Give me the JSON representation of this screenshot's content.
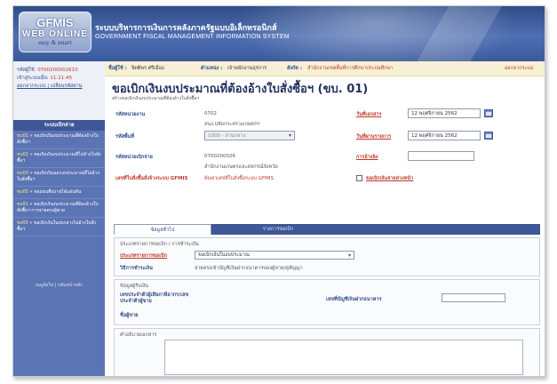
{
  "header": {
    "logo_line1": "GFMIS",
    "logo_line2": "WEB ONLINE",
    "logo_line3": "easy & smart",
    "title_th": "ระบบบริหารการเงินการคลังภาครัฐแบบอิเล็กทรอนิกส์",
    "title_en": "GOVERNMENT FISCAL MANAGEMENT INFORMATION SYSTEM"
  },
  "user": {
    "user_label": "รหัสผู้ใช้:",
    "user_value": "0700200002610",
    "time_label": "เข้าสู่ระบบเมื่อ:",
    "time_value": "11:21:45",
    "menu_link": "ออกจากระบบ | เปลี่ยนรหัสผ่าน"
  },
  "sidebar": {
    "heading": "ระบบเบิกจ่าย",
    "items": [
      {
        "code": "ขบ01",
        "label": "» ขอเบิกเงินงบประมาณที่ต้องอ้างใบสั่งซื้อฯ"
      },
      {
        "code": "ขบ02",
        "label": "» ขอเบิกเงินงบประมาณที่ไม่อ้างใบสั่งซื้อฯ"
      },
      {
        "code": "ขบ03",
        "label": "» ขอเบิกเงินนอกงบประมาณที่ไม่อ้างใบสั่งซื้อฯ"
      },
      {
        "code": "ขบ05",
        "label": "» ขอถอนคืนรายได้แผ่นดิน"
      },
      {
        "code": "ขจ01",
        "label": "» ขอเบิกเงินงบประมาณที่ต้องอ้างใบสั่งซื้อฯ การจ่ายตรงผู้ขาย"
      },
      {
        "code": "ขจ05",
        "label": "» ขอเบิกเงินในงบกลางไม่อ้างใบสั่งซื้อฯ"
      }
    ],
    "footer": "เมนูถัดไป | กลับหน้าหลัก"
  },
  "infobar": {
    "user_key": "ชื่อผู้ใช้ :",
    "user_name": "จิตติพร ศรีเมือง",
    "position_key": "ตำแหน่ง :",
    "position_value": "เจ้าพนักงานธุรการ",
    "org_key": "สังกัด :",
    "org_value": "สำนักงานเขตพื้นที่การศึกษาประถมศึกษา",
    "logout": "ออกจากระบบ"
  },
  "page": {
    "title": "ขอเบิกเงินงบประมาณที่ต้องอ้างใบสั่งซื้อฯ (ขบ. 01)",
    "subtitle": "สร้างขอเบิกเงินงบประมาณที่ต้องอ้างใบสั่งซื้อฯ"
  },
  "form": {
    "dept_label": "รหัสหน่วยงาน",
    "dept_code": "0702",
    "dept_name": "สนง.ปลัดกระทรวงเกษตรฯ",
    "area_label": "รหัสพื้นที่",
    "area_value": "1000 - ส่วนกลาง",
    "pay_unit_label": "รหัสหน่วยเบิกจ่าย",
    "pay_unit_code": "0700200026",
    "pay_unit_name": "สำนักงานเกษตรและสหกรณ์จังหวัด",
    "po_label": "เลขที่ใบสั่งซื้อสั่งจ้างระบบ GFMIS",
    "po_hint": "ค้นหาเลขที่ใบสั่งซื้อระบบ GFMIS",
    "doc_date_label": "วันที่เอกสาร",
    "doc_date_value": "12 พฤศจิกายน 2562",
    "post_date_label": "วันที่ผ่านรายการ",
    "post_date_value": "12 พฤศจิกายน 2562",
    "ref_label": "การอ้างอิง",
    "ref_value": "",
    "advance_label": "ขอเบิกเงินจ่ายล่วงหน้า"
  },
  "tabs": {
    "general": "ข้อมูลทั่วไป",
    "items": "รายการขอเบิก"
  },
  "payment": {
    "section_title": "ประเภทรายการขอเบิก / การชำระเงิน",
    "type_label": "ประเภทรายการขอเบิก",
    "type_value": "ขอเบิกเงินในงบประมาณ",
    "method_label": "วิธีการชำระเงิน",
    "method_value": "จ่ายตรงเข้าบัญชีเงินฝากธนาคารของผู้ขาย/คู่สัญญา"
  },
  "recipient": {
    "section_title": "ข้อมูลผู้รับเงิน",
    "tax_label": "เลขประจำตัวผู้เสียภาษีอากร/เลขประจำตัวผู้ขาย",
    "bank_label": "เลขที่บัญชีเงินฝากธนาคาร",
    "bank_value": "",
    "name_label": "ชื่อผู้ขาย"
  },
  "description": {
    "label": "คำอธิบายเอกสาร",
    "value": ""
  }
}
